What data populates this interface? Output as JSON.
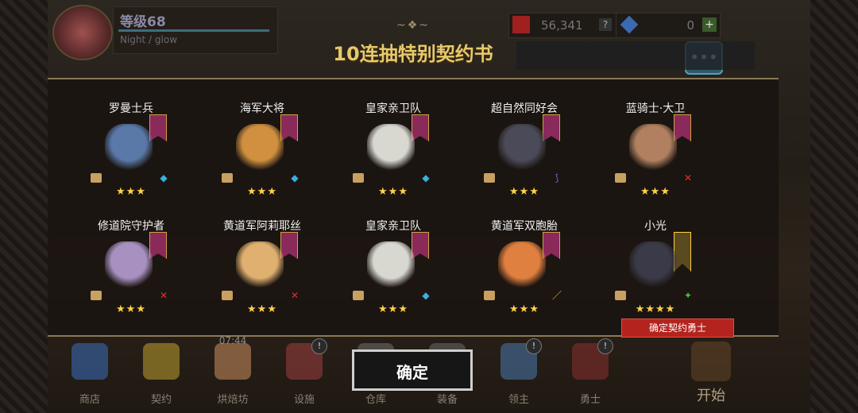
{
  "header": {
    "level": "等级68",
    "player_name": "Night / glow",
    "gold": "56,341",
    "gold_help": "?",
    "gems": "0",
    "gems_add": "+"
  },
  "dialog": {
    "title": "10连抽特别契约书",
    "confirm_button": "确定",
    "confirm_tag": "确定契约勇士"
  },
  "heroes": [
    {
      "name": "罗曼士兵",
      "stars": "★★★",
      "banner_color": "#8a2a5a",
      "sprite_color": "#5a78a8",
      "weapon_icon": "axe-icon",
      "weapon_color": "#3ab0e0"
    },
    {
      "name": "海军大将",
      "stars": "★★★",
      "banner_color": "#8a2a5a",
      "sprite_color": "#d09040",
      "weapon_icon": "axe-icon",
      "weapon_color": "#3ab0e0"
    },
    {
      "name": "皇家亲卫队",
      "stars": "★★★",
      "banner_color": "#8a2a5a",
      "sprite_color": "#d8d8d0",
      "weapon_icon": "axe-icon",
      "weapon_color": "#3ab0e0"
    },
    {
      "name": "超自然同好会",
      "stars": "★★★",
      "banner_color": "#8a2a5a",
      "sprite_color": "#4a4a58",
      "weapon_icon": "staff-icon",
      "weapon_color": "#8a5ad0"
    },
    {
      "name": "蓝骑士·大卫",
      "stars": "★★★",
      "banner_color": "#8a2a5a",
      "sprite_color": "#b08060",
      "weapon_icon": "crossed-swords-icon",
      "weapon_color": "#e03030"
    },
    {
      "name": "修道院守护者",
      "stars": "★★★",
      "banner_color": "#8a2a5a",
      "sprite_color": "#a890c0",
      "weapon_icon": "crossed-swords-icon",
      "weapon_color": "#e03030"
    },
    {
      "name": "黄道军阿莉耶丝",
      "stars": "★★★",
      "banner_color": "#8a2a5a",
      "sprite_color": "#e0b070",
      "weapon_icon": "crossed-swords-icon",
      "weapon_color": "#e03030"
    },
    {
      "name": "皇家亲卫队",
      "stars": "★★★",
      "banner_color": "#8a2a5a",
      "sprite_color": "#d8d8d0",
      "weapon_icon": "axe-icon",
      "weapon_color": "#3ab0e0"
    },
    {
      "name": "黄道军双胞胎",
      "stars": "★★★",
      "banner_color": "#8a2a5a",
      "sprite_color": "#e08040",
      "weapon_icon": "sword-icon",
      "weapon_color": "#e0c030"
    },
    {
      "name": "小光",
      "stars": "★★★★",
      "banner_color": "#5a4a20",
      "sprite_color": "#3a3a48",
      "weapon_icon": "star-weapon-icon",
      "weapon_color": "#40c040"
    }
  ],
  "nav": [
    {
      "label": "商店",
      "badge": "",
      "time": "",
      "color": "#3a70c0"
    },
    {
      "label": "契约",
      "badge": "",
      "time": "",
      "color": "#c0a030"
    },
    {
      "label": "烘焙坊",
      "badge": "",
      "time": "07:44",
      "color": "#d09060"
    },
    {
      "label": "设施",
      "badge": "!",
      "time": "",
      "color": "#a04040"
    },
    {
      "label": "仓库",
      "badge": "",
      "time": "",
      "color": "#707070"
    },
    {
      "label": "装备",
      "badge": "",
      "time": "",
      "color": "#6a6a6a"
    },
    {
      "label": "领主",
      "badge": "!",
      "time": "",
      "color": "#4a7ab0"
    },
    {
      "label": "勇士",
      "badge": "!",
      "time": "",
      "color": "#8a3030"
    }
  ],
  "start": {
    "label": "开始"
  }
}
